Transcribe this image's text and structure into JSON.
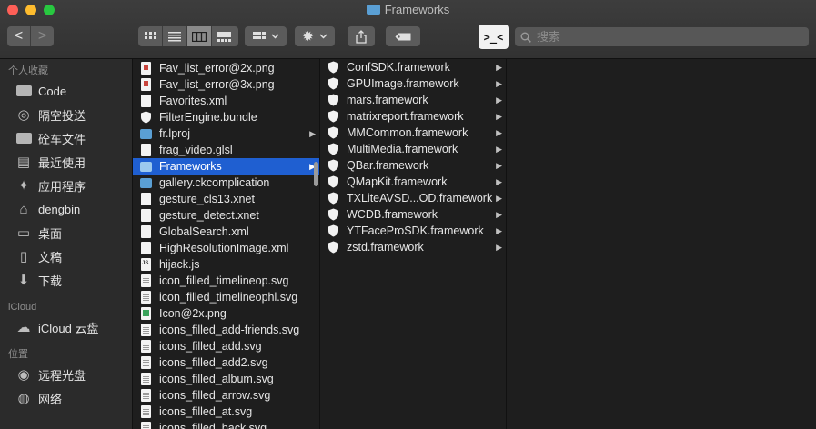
{
  "window": {
    "title": "Frameworks"
  },
  "toolbar": {
    "back_glyph": "<",
    "forward_glyph": ">",
    "terminal_label": ">_<",
    "search_placeholder": "搜索"
  },
  "sidebar": {
    "favorites_header": "个人收藏",
    "favorites": [
      {
        "label": "Code",
        "icon": "folder-icon"
      },
      {
        "label": "隔空投送",
        "icon": "airdrop-icon"
      },
      {
        "label": "砼车文件",
        "icon": "folder-icon"
      },
      {
        "label": "最近使用",
        "icon": "recents-icon"
      },
      {
        "label": "应用程序",
        "icon": "applications-icon"
      },
      {
        "label": "dengbin",
        "icon": "home-icon"
      },
      {
        "label": "桌面",
        "icon": "desktop-icon"
      },
      {
        "label": "文稿",
        "icon": "documents-icon"
      },
      {
        "label": "下载",
        "icon": "downloads-icon"
      }
    ],
    "icloud_header": "iCloud",
    "icloud": [
      {
        "label": "iCloud 云盘",
        "icon": "cloud-icon"
      }
    ],
    "locations_header": "位置",
    "locations": [
      {
        "label": "远程光盘",
        "icon": "disc-icon"
      },
      {
        "label": "网络",
        "icon": "network-icon"
      }
    ]
  },
  "column1": [
    {
      "name": "Fav_list_error@2x.png",
      "type": "png"
    },
    {
      "name": "Fav_list_error@3x.png",
      "type": "png"
    },
    {
      "name": "Favorites.xml",
      "type": "doc"
    },
    {
      "name": "FilterEngine.bundle",
      "type": "bundle"
    },
    {
      "name": "fr.lproj",
      "type": "folder",
      "expandable": true
    },
    {
      "name": "frag_video.glsl",
      "type": "doc"
    },
    {
      "name": "Frameworks",
      "type": "folder",
      "expandable": true,
      "selected": true
    },
    {
      "name": "gallery.ckcomplication",
      "type": "folder"
    },
    {
      "name": "gesture_cls13.xnet",
      "type": "doc"
    },
    {
      "name": "gesture_detect.xnet",
      "type": "doc"
    },
    {
      "name": "GlobalSearch.xml",
      "type": "doc"
    },
    {
      "name": "HighResolutionImage.xml",
      "type": "doc"
    },
    {
      "name": "hijack.js",
      "type": "js"
    },
    {
      "name": "icon_filled_timelineop.svg",
      "type": "code"
    },
    {
      "name": "icon_filled_timelineophl.svg",
      "type": "code"
    },
    {
      "name": "Icon@2x.png",
      "type": "img"
    },
    {
      "name": "icons_filled_add-friends.svg",
      "type": "code"
    },
    {
      "name": "icons_filled_add.svg",
      "type": "code"
    },
    {
      "name": "icons_filled_add2.svg",
      "type": "code"
    },
    {
      "name": "icons_filled_album.svg",
      "type": "code"
    },
    {
      "name": "icons_filled_arrow.svg",
      "type": "code"
    },
    {
      "name": "icons_filled_at.svg",
      "type": "code"
    },
    {
      "name": "icons_filled_back.svg",
      "type": "code"
    }
  ],
  "column2": [
    {
      "name": "ConfSDK.framework"
    },
    {
      "name": "GPUImage.framework"
    },
    {
      "name": "mars.framework"
    },
    {
      "name": "matrixreport.framework"
    },
    {
      "name": "MMCommon.framework"
    },
    {
      "name": "MultiMedia.framework"
    },
    {
      "name": "QBar.framework"
    },
    {
      "name": "QMapKit.framework"
    },
    {
      "name": "TXLiteAVSD...OD.framework"
    },
    {
      "name": "WCDB.framework"
    },
    {
      "name": "YTFaceProSDK.framework"
    },
    {
      "name": "zstd.framework"
    }
  ]
}
